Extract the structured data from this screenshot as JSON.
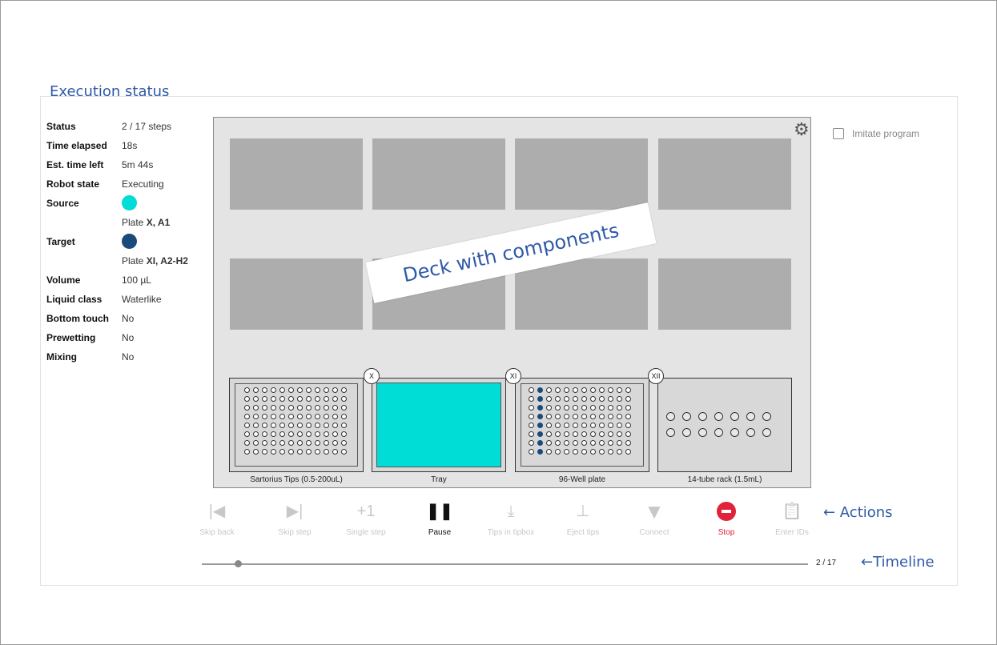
{
  "annotations": {
    "execution_status": "Execution status",
    "deck": "Deck with components",
    "actions": "← Actions",
    "timeline": "←Timeline"
  },
  "status": {
    "rows": [
      {
        "label": "Status",
        "value": "2 / 17 steps"
      },
      {
        "label": "Time elapsed",
        "value": "18s"
      },
      {
        "label": "Est. time left",
        "value": "5m 44s"
      },
      {
        "label": "Robot state",
        "value": "Executing"
      }
    ],
    "source": {
      "label": "Source",
      "color": "#00dcd6",
      "plate_prefix": "Plate ",
      "plate": "X, A1"
    },
    "target": {
      "label": "Target",
      "color": "#1a4a7a",
      "plate_prefix": "Plate ",
      "plate": "XI, A2-H2"
    },
    "rows2": [
      {
        "label": "Volume",
        "value": "100 µL"
      },
      {
        "label": "Liquid class",
        "value": "Waterlike"
      },
      {
        "label": "Bottom touch",
        "value": "No"
      },
      {
        "label": "Prewetting",
        "value": "No"
      },
      {
        "label": "Mixing",
        "value": "No"
      }
    ]
  },
  "imitate_label": "Imitate program",
  "deck": {
    "badges": [
      "X",
      "XI",
      "XII"
    ],
    "plates": [
      {
        "name": "Sartorius Tips (0.5-200uL)"
      },
      {
        "name": "Tray"
      },
      {
        "name": "96-Well plate"
      },
      {
        "name": "14-tube rack (1.5mL)"
      }
    ]
  },
  "toolbar": [
    {
      "label": "Skip back",
      "icon": "skip-back-icon",
      "glyph": "|◀"
    },
    {
      "label": "Skip step",
      "icon": "skip-forward-icon",
      "glyph": "▶|"
    },
    {
      "label": "Single step",
      "icon": "plus-one-icon",
      "glyph": "+1"
    },
    {
      "label": "Pause",
      "icon": "pause-icon",
      "glyph": "❚❚"
    },
    {
      "label": "Tips in tipbox",
      "icon": "tips-in-tipbox-icon",
      "glyph": "⤓"
    },
    {
      "label": "Eject tips",
      "icon": "eject-tips-icon",
      "glyph": "⊥"
    },
    {
      "label": "Connect",
      "icon": "wifi-icon",
      "glyph": "▼"
    },
    {
      "label": "Stop",
      "icon": "stop-icon",
      "glyph": ""
    },
    {
      "label": "Enter IDs",
      "icon": "clipboard-icon",
      "glyph": "📋"
    }
  ],
  "timeline": {
    "current": 2,
    "total": 17,
    "count_label": "2 / 17"
  },
  "colors": {
    "accent": "#2f5aa8",
    "stop": "#e0223a",
    "tray": "#00dcd6",
    "filled_well": "#1a4a7a"
  }
}
